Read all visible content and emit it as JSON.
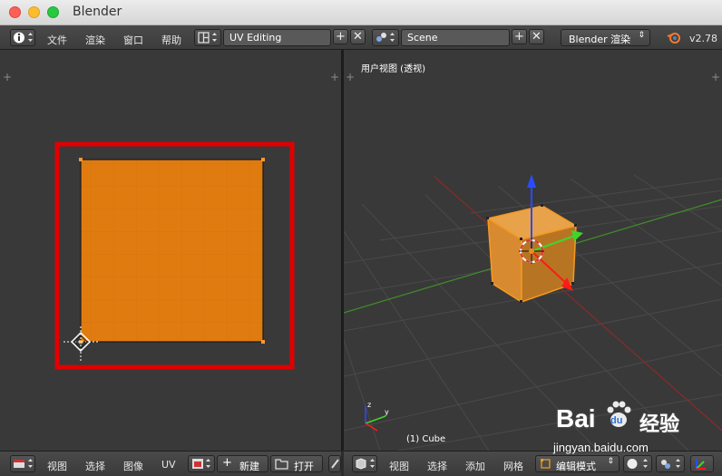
{
  "window": {
    "title": "Blender"
  },
  "info_header": {
    "menus": [
      "文件",
      "渲染",
      "窗口",
      "帮助"
    ],
    "layout": "UV Editing",
    "scene": "Scene",
    "engine": "Blender 渲染",
    "version": "v2.78"
  },
  "view3d": {
    "view_label": "用户视图 (透视)",
    "object_label": "(1) Cube",
    "footer": {
      "menus": [
        "视图",
        "选择",
        "添加",
        "网格"
      ],
      "mode": "编辑模式"
    }
  },
  "uv_editor": {
    "footer": {
      "menus": [
        "视图",
        "选择",
        "图像",
        "UV"
      ],
      "new_label": "新建",
      "open_label": "打开"
    }
  },
  "watermark": {
    "brand": "Bai",
    "brand2": "du",
    "site": "经验",
    "url": "jingyan.baidu.com"
  },
  "colors": {
    "uv_face": "#e07b10",
    "highlight_box": "#e00000",
    "background": "#393939"
  }
}
